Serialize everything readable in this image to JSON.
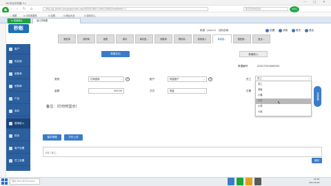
{
  "window": {
    "title": "360安全浏览器 9.1",
    "controls": [
      "—",
      "□",
      "✕"
    ]
  },
  "browser": {
    "logo": "e",
    "url": "http://sj.ydxfb.com/page/index.asp?SESSIONID=39643268&ViewMode=1",
    "search_placeholder": "数字防伪码查询",
    "cpu": "80%",
    "bookmarks": [
      "☆ 收藏",
      "⊡ 手机收藏夹",
      "⊡ 谷歌",
      "⊡ 网址大全",
      "⊡ 游戏中心"
    ],
    "tabs": [
      "⊕ 常用网址",
      "易订货单据"
    ]
  },
  "app": {
    "logo": "秒账",
    "user": "帐套（yayun）  当前店铺",
    "header_buttons": [
      "设置",
      "消息",
      "首页",
      "退出"
    ]
  },
  "module_tabs": [
    "销售单",
    "采购单",
    "报表",
    "库存",
    "库存盘...",
    "调拨单",
    "物料领...",
    "费用收入",
    "新增费...",
    "报损报...",
    "盘点..."
  ],
  "sidebar": [
    "客户",
    "供应商",
    "销售单",
    "采购单",
    "产品",
    "库存",
    "费用收入",
    "财务",
    "客户设置",
    "员工设置"
  ],
  "form": {
    "new_button": "新增支出",
    "income_button": "新增收入",
    "doc_no_label": "单据编号",
    "doc_no": "Z2017051800003",
    "category_label": "类别",
    "category_value": "日常费用",
    "account_label": "账户",
    "account_value": "现金账户",
    "staff_label": "员工",
    "staff_value": "员工",
    "amount_label": "金额",
    "amount_value": "400.00",
    "method_label": "方式",
    "method_value": "现金",
    "date_label": "日期",
    "remark_title": "备注：（打印时显示）",
    "save_button": "保存单据",
    "print_button": "打印上传",
    "memo_placeholder": "请输入备注...",
    "memo_button": "保存"
  },
  "dropdown": {
    "options": [
      "员工",
      "老板",
      "小春",
      "小王",
      "小李",
      "小赵"
    ],
    "selected_index": 3
  },
  "float_tab": "在线客服",
  "taskbar": {
    "search_placeholder": "搜索 Web 和 Windows",
    "time": "16:30",
    "date": "2017/5/18"
  }
}
